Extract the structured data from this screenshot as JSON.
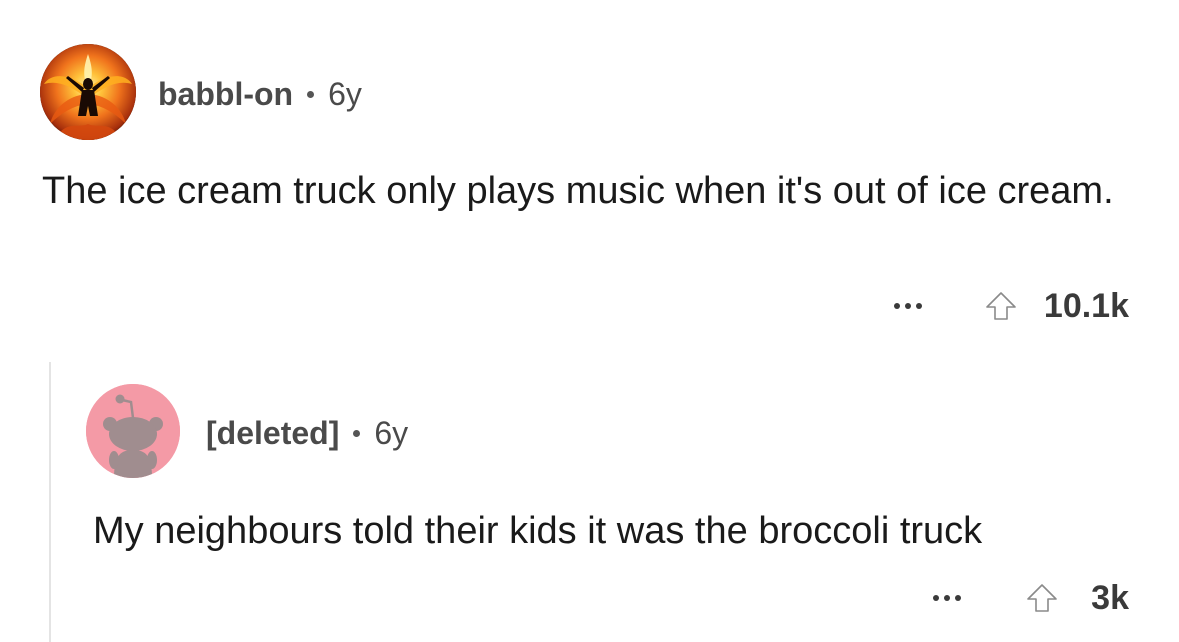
{
  "comment": {
    "username": "babbl-on",
    "age": "6y",
    "body": "The ice cream truck only plays music when it's out of ice cream.",
    "score": "10.1k",
    "avatar_icon": "phoenix-avatar-icon"
  },
  "reply": {
    "username": "[deleted]",
    "age": "6y",
    "body": "My neighbours told their kids it was the broccoli truck",
    "score": "3k",
    "avatar_icon": "snoo-avatar-icon"
  },
  "icons": {
    "more": "more-options-icon",
    "upvote": "upvote-arrow-icon"
  },
  "colors": {
    "background": "#ffffff",
    "text": "#1a1a1a",
    "meta": "#4a4a4a",
    "thread_line": "#e4e4e4",
    "deleted_avatar_bg": "#f49aa6",
    "snoo_fill": "#a08d8f"
  }
}
